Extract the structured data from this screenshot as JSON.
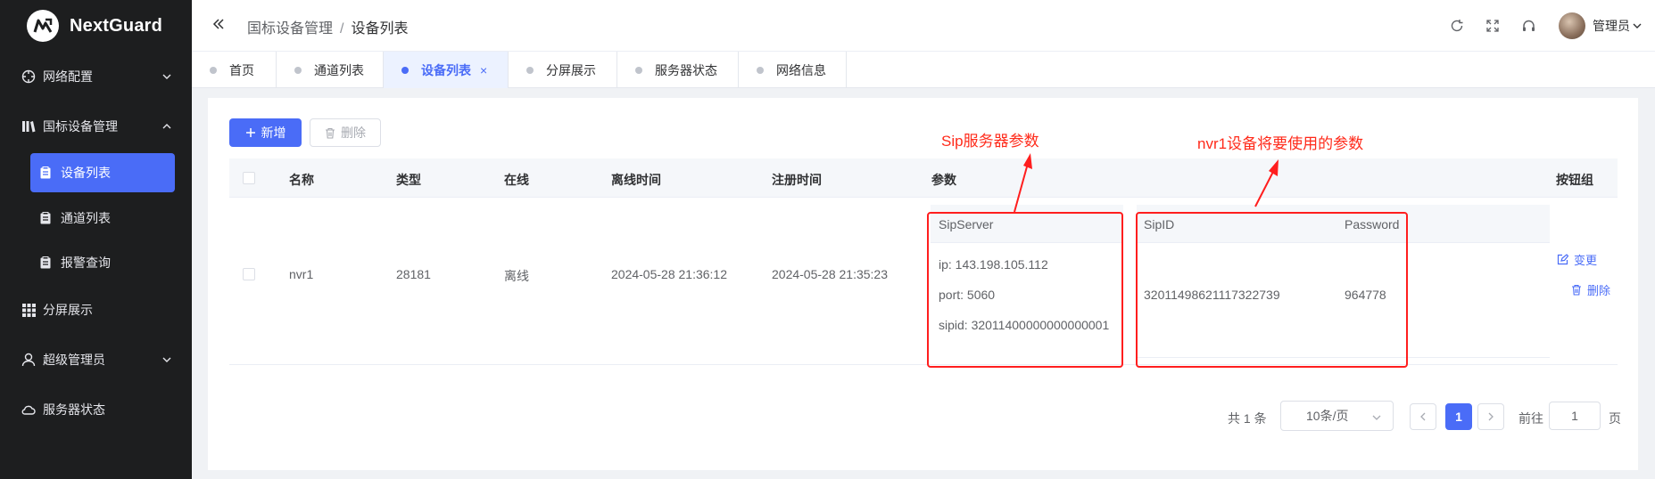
{
  "app": {
    "name": "NextGuard"
  },
  "sidebar": {
    "items": [
      {
        "label": "网络配置"
      },
      {
        "label": "国标设备管理"
      },
      {
        "label": "设备列表"
      },
      {
        "label": "通道列表"
      },
      {
        "label": "报警查询"
      },
      {
        "label": "分屏展示"
      },
      {
        "label": "超级管理员"
      },
      {
        "label": "服务器状态"
      }
    ]
  },
  "header": {
    "breadcrumb": [
      "国标设备管理",
      "设备列表"
    ],
    "separator": "/",
    "user": "管理员"
  },
  "tabs": [
    {
      "label": "首页"
    },
    {
      "label": "通道列表"
    },
    {
      "label": "设备列表",
      "close": "×"
    },
    {
      "label": "分屏展示"
    },
    {
      "label": "服务器状态"
    },
    {
      "label": "网络信息"
    }
  ],
  "toolbar": {
    "add_label": "新增",
    "delete_label": "删除"
  },
  "table": {
    "columns": [
      "名称",
      "类型",
      "在线",
      "离线时间",
      "注册时间",
      "参数",
      "按钮组"
    ],
    "rows": [
      {
        "name": "nvr1",
        "type": "28181",
        "online": "离线",
        "offline_time": "2024-05-28 21:36:12",
        "register_time": "2024-05-28 21:35:23",
        "sip_server": {
          "header": "SipServer",
          "ip": "ip: 143.198.105.112",
          "port": "port: 5060",
          "sipid": "sipid: 32011400000000000001"
        },
        "device": {
          "sipid_header": "SipID",
          "password_header": "Password",
          "sipid": "32011498621117322739",
          "password": "964778"
        },
        "actions": {
          "edit": "变更",
          "delete": "删除"
        }
      }
    ]
  },
  "annotations": {
    "sip_server": "Sip服务器参数",
    "device": "nvr1设备将要使用的参数",
    "color": "#ff1e1e"
  },
  "pagination": {
    "total": "共 1 条",
    "page_size": "10条/页",
    "current": "1",
    "goto_label": "前往",
    "goto_value": "1",
    "page_unit": "页"
  },
  "colors": {
    "primary": "#4a6cf7",
    "sidebar_bg": "#1d1e1f"
  }
}
